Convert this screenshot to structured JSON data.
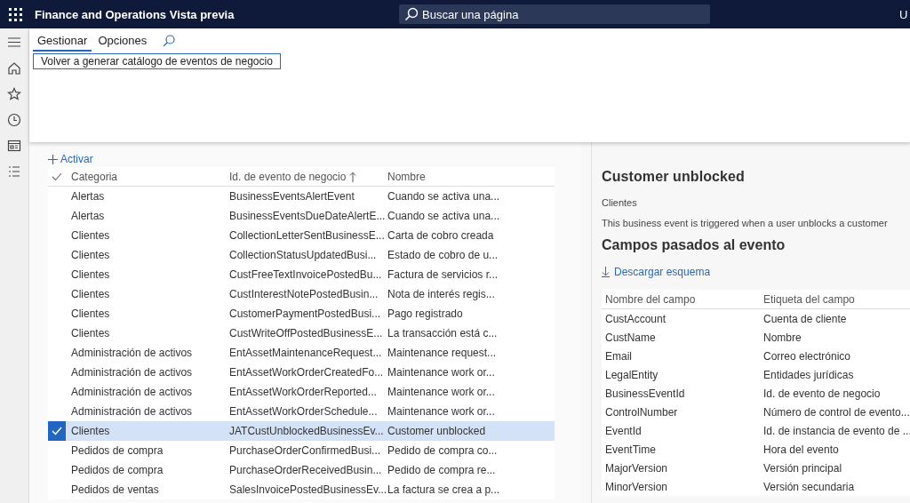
{
  "top_bar": {
    "app_title": "Finance and Operations Vista previa",
    "search": {
      "placeholder": "Buscar una página"
    },
    "user_initial": "U"
  },
  "ribbon": {
    "tabs": [
      {
        "label": "Gestionar",
        "selected": true
      },
      {
        "label": "Opciones",
        "selected": false
      }
    ],
    "actions": [
      {
        "label": "Volver a generar catálogo de eventos de negocio",
        "focused": true
      }
    ]
  },
  "toolbar": {
    "activate_label": "Activar"
  },
  "events_table": {
    "columns": [
      {
        "label": "Categoria",
        "sorted": false
      },
      {
        "label": "Id. de evento de negocio",
        "sorted": true
      },
      {
        "label": "Nombre",
        "sorted": false
      }
    ],
    "rows": [
      {
        "category": "Alertas",
        "event_id": "BusinessEventsAlertEvent",
        "name": "Cuando se activa una...",
        "selected": false
      },
      {
        "category": "Alertas",
        "event_id": "BusinessEventsDueDateAlertE...",
        "name": "Cuando se activa una...",
        "selected": false
      },
      {
        "category": "Clientes",
        "event_id": "CollectionLetterSentBusinessE...",
        "name": "Carta de cobro creada",
        "selected": false
      },
      {
        "category": "Clientes",
        "event_id": "CollectionStatusUpdatedBusi...",
        "name": "Estado de cobro de u...",
        "selected": false
      },
      {
        "category": "Clientes",
        "event_id": "CustFreeTextInvoicePostedBu...",
        "name": "Factura de servicios r...",
        "selected": false
      },
      {
        "category": "Clientes",
        "event_id": "CustInterestNotePostedBusin...",
        "name": "Nota de interés regis...",
        "selected": false
      },
      {
        "category": "Clientes",
        "event_id": "CustomerPaymentPostedBusi...",
        "name": "Pago registrado",
        "selected": false
      },
      {
        "category": "Clientes",
        "event_id": "CustWriteOffPostedBusinessE...",
        "name": "La transacción está c...",
        "selected": false
      },
      {
        "category": "Administración de activos",
        "event_id": "EntAssetMaintenanceRequest...",
        "name": "Maintenance request...",
        "selected": false
      },
      {
        "category": "Administración de activos",
        "event_id": "EntAssetWorkOrderCreatedFo...",
        "name": "Maintenance work or...",
        "selected": false
      },
      {
        "category": "Administración de activos",
        "event_id": "EntAssetWorkOrderReported...",
        "name": "Maintenance work or...",
        "selected": false
      },
      {
        "category": "Administración de activos",
        "event_id": "EntAssetWorkOrderSchedule...",
        "name": "Maintenance work or...",
        "selected": false
      },
      {
        "category": "Clientes",
        "event_id": "JATCustUnblockedBusinessEv...",
        "name": "Customer unblocked",
        "selected": true
      },
      {
        "category": "Pedidos de compra",
        "event_id": "PurchaseOrderConfirmedBusi...",
        "name": "Pedido de compra co...",
        "selected": false
      },
      {
        "category": "Pedidos de compra",
        "event_id": "PurchaseOrderReceivedBusin...",
        "name": "Pedido de compra re...",
        "selected": false
      },
      {
        "category": "Pedidos de ventas",
        "event_id": "SalesInvoicePostedBusinessEv...",
        "name": "La factura se crea a p...",
        "selected": false
      }
    ]
  },
  "detail": {
    "title": "Customer unblocked",
    "category": "Clientes",
    "description": "This business event is triggered when a user unblocks a customer",
    "fields_heading": "Campos pasados al evento",
    "download_label": "Descargar esquema",
    "fields_table": {
      "columns": [
        "Nombre del campo",
        "Etiqueta del campo"
      ],
      "rows": [
        {
          "field": "CustAccount",
          "label": "Cuenta de cliente"
        },
        {
          "field": "CustName",
          "label": "Nombre"
        },
        {
          "field": "Email",
          "label": "Correo electrónico"
        },
        {
          "field": "LegalEntity",
          "label": "Entidades jurídicas"
        },
        {
          "field": "BusinessEventId",
          "label": "Id. de evento de negocio"
        },
        {
          "field": "ControlNumber",
          "label": "Número de control de evento..."
        },
        {
          "field": "EventId",
          "label": "Id. de instancia de evento de ..."
        },
        {
          "field": "EventTime",
          "label": "Hora del evento"
        },
        {
          "field": "MajorVersion",
          "label": "Versión principal"
        },
        {
          "field": "MinorVersion",
          "label": "Versión secundaria"
        }
      ]
    }
  }
}
